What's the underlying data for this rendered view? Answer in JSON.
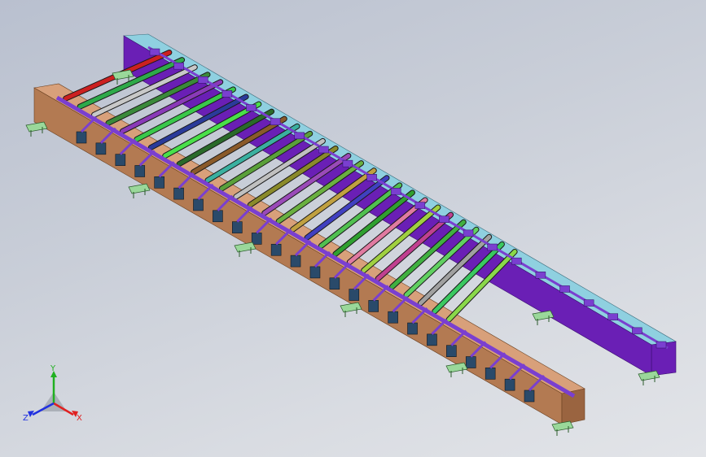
{
  "colors": {
    "background_top": "#b9c0cf",
    "background_bottom": "#e2e4e8",
    "left_beam_top": "#d8a07a",
    "left_beam_side": "#b37a52",
    "right_beam_top": "#8fd0e0",
    "right_beam_side": "#6a1fb5",
    "chain_purple": "#7a3fd0",
    "foot_green": "#9ad89a",
    "axis_x": "#e02020",
    "axis_y": "#20b020",
    "axis_z": "#2030e0"
  },
  "rollers": [
    "#cc2020",
    "#2eaa4a",
    "#c8c8c8",
    "#3a8a3a",
    "#8a3ab8",
    "#3ac84a",
    "#2a3a9a",
    "#4ae04a",
    "#2a6a2a",
    "#8a5a2a",
    "#3ab0a0",
    "#5aa03a",
    "#c0c0c0",
    "#8a8a2a",
    "#9a4ab8",
    "#6ab040",
    "#c0a040",
    "#4040c0",
    "#50c050",
    "#30a030",
    "#e07aa0",
    "#a0d040",
    "#c04090",
    "#40b040",
    "#60d060",
    "#a0a0a0",
    "#3ac860",
    "#8ad84a"
  ],
  "triad": {
    "x_label": "X",
    "y_label": "Y",
    "z_label": "Z"
  }
}
